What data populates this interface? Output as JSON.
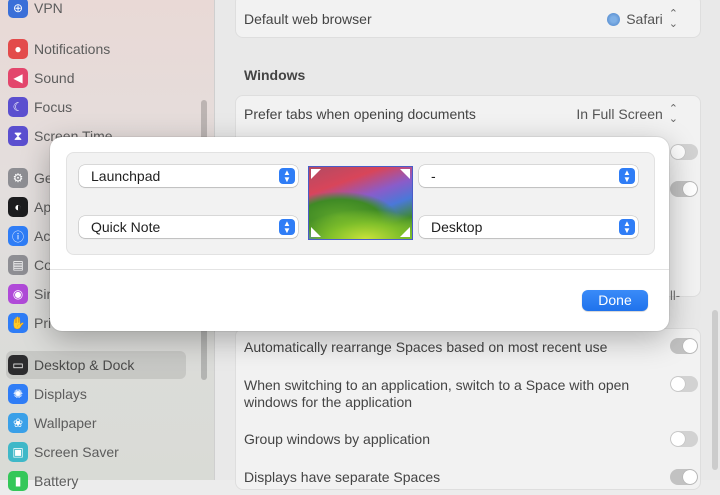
{
  "sidebar": {
    "items": [
      {
        "label": "VPN",
        "icon": "globe-icon",
        "color": "#3a6fd8",
        "glyph": "⊕"
      },
      {
        "label": "Notifications",
        "icon": "bell-icon",
        "color": "#e34b4b",
        "glyph": "●"
      },
      {
        "label": "Sound",
        "icon": "speaker-icon",
        "color": "#e3466c",
        "glyph": "◀"
      },
      {
        "label": "Focus",
        "icon": "moon-icon",
        "color": "#5b4fcf",
        "glyph": "☾"
      },
      {
        "label": "Screen Time",
        "icon": "hourglass-icon",
        "color": "#5b4fcf",
        "glyph": "⧗"
      },
      {
        "label": "General",
        "icon": "gear-icon",
        "color": "#8e8e93",
        "glyph": "⚙"
      },
      {
        "label": "Appearance",
        "icon": "appearance-icon",
        "color": "#1c1c1e",
        "glyph": "◐"
      },
      {
        "label": "Accessibility",
        "icon": "accessibility-icon",
        "color": "#2f7df6",
        "glyph": "ⓘ"
      },
      {
        "label": "Control Centre",
        "icon": "control-centre-icon",
        "color": "#8e8e93",
        "glyph": "▤"
      },
      {
        "label": "Siri & Spotlight",
        "icon": "siri-icon",
        "color": "#b04ad8",
        "glyph": "◉"
      },
      {
        "label": "Privacy & Security",
        "icon": "hand-icon",
        "color": "#2f7df6",
        "glyph": "✋"
      },
      {
        "label": "Desktop & Dock",
        "icon": "dock-icon",
        "color": "#2c2c2e",
        "glyph": "▭"
      },
      {
        "label": "Displays",
        "icon": "sun-icon",
        "color": "#2f7df6",
        "glyph": "✺"
      },
      {
        "label": "Wallpaper",
        "icon": "flower-icon",
        "color": "#3aa0e8",
        "glyph": "❀"
      },
      {
        "label": "Screen Saver",
        "icon": "screensaver-icon",
        "color": "#3fb8c8",
        "glyph": "▣"
      },
      {
        "label": "Battery",
        "icon": "battery-icon",
        "color": "#34c759",
        "glyph": "▮"
      }
    ]
  },
  "main": {
    "default_browser": {
      "label": "Default web browser",
      "value": "Safari"
    },
    "windows_title": "Windows",
    "prefer_tabs": {
      "label": "Prefer tabs when opening documents",
      "value": "In Full Screen"
    },
    "peek_text": "ll-",
    "auto_rearrange": {
      "label": "Automatically rearrange Spaces based on most recent use"
    },
    "switch_space": {
      "label_line1": "When switching to an application, switch to a Space with open",
      "label_line2": "windows for the application"
    },
    "group_windows": {
      "label": "Group windows by application"
    },
    "separate_spaces": {
      "label": "Displays have separate Spaces"
    }
  },
  "sheet": {
    "top_left": "Launchpad",
    "top_right": "-",
    "bottom_left": "Quick Note",
    "bottom_right": "Desktop",
    "done_label": "Done"
  },
  "colors": {
    "accent": "#2f7df6"
  }
}
